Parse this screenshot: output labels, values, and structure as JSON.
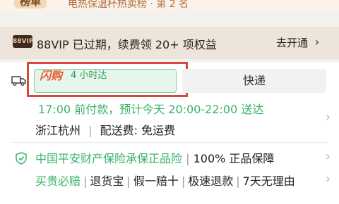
{
  "rank_strip": {
    "badge": "榜单",
    "text": "电热保温杯热卖榜 · 第 2 名"
  },
  "vip": {
    "badge": "88VIP",
    "text": "88VIP 已过期，续费领 20+ 项权益",
    "cta": "去开通"
  },
  "delivery": {
    "flash_label": "闪购",
    "flash_time": "4 小时达",
    "express_label": "快递",
    "pay_info": "17:00 前付款，预计今天 20:00-22:00 送达",
    "location": "浙江杭州",
    "shipping": "配送费: 免运费"
  },
  "guarantee": {
    "insurance": "中国平安财产保险承保正品险",
    "quality": "100% 正品保障",
    "services": [
      "买贵必赔",
      "退货宝",
      "假一赔十",
      "极速退款",
      "7天无理由"
    ]
  },
  "colors": {
    "accent_green": "#38b267",
    "flash_orange": "#e95b2d",
    "highlight_red": "#d7483e"
  }
}
